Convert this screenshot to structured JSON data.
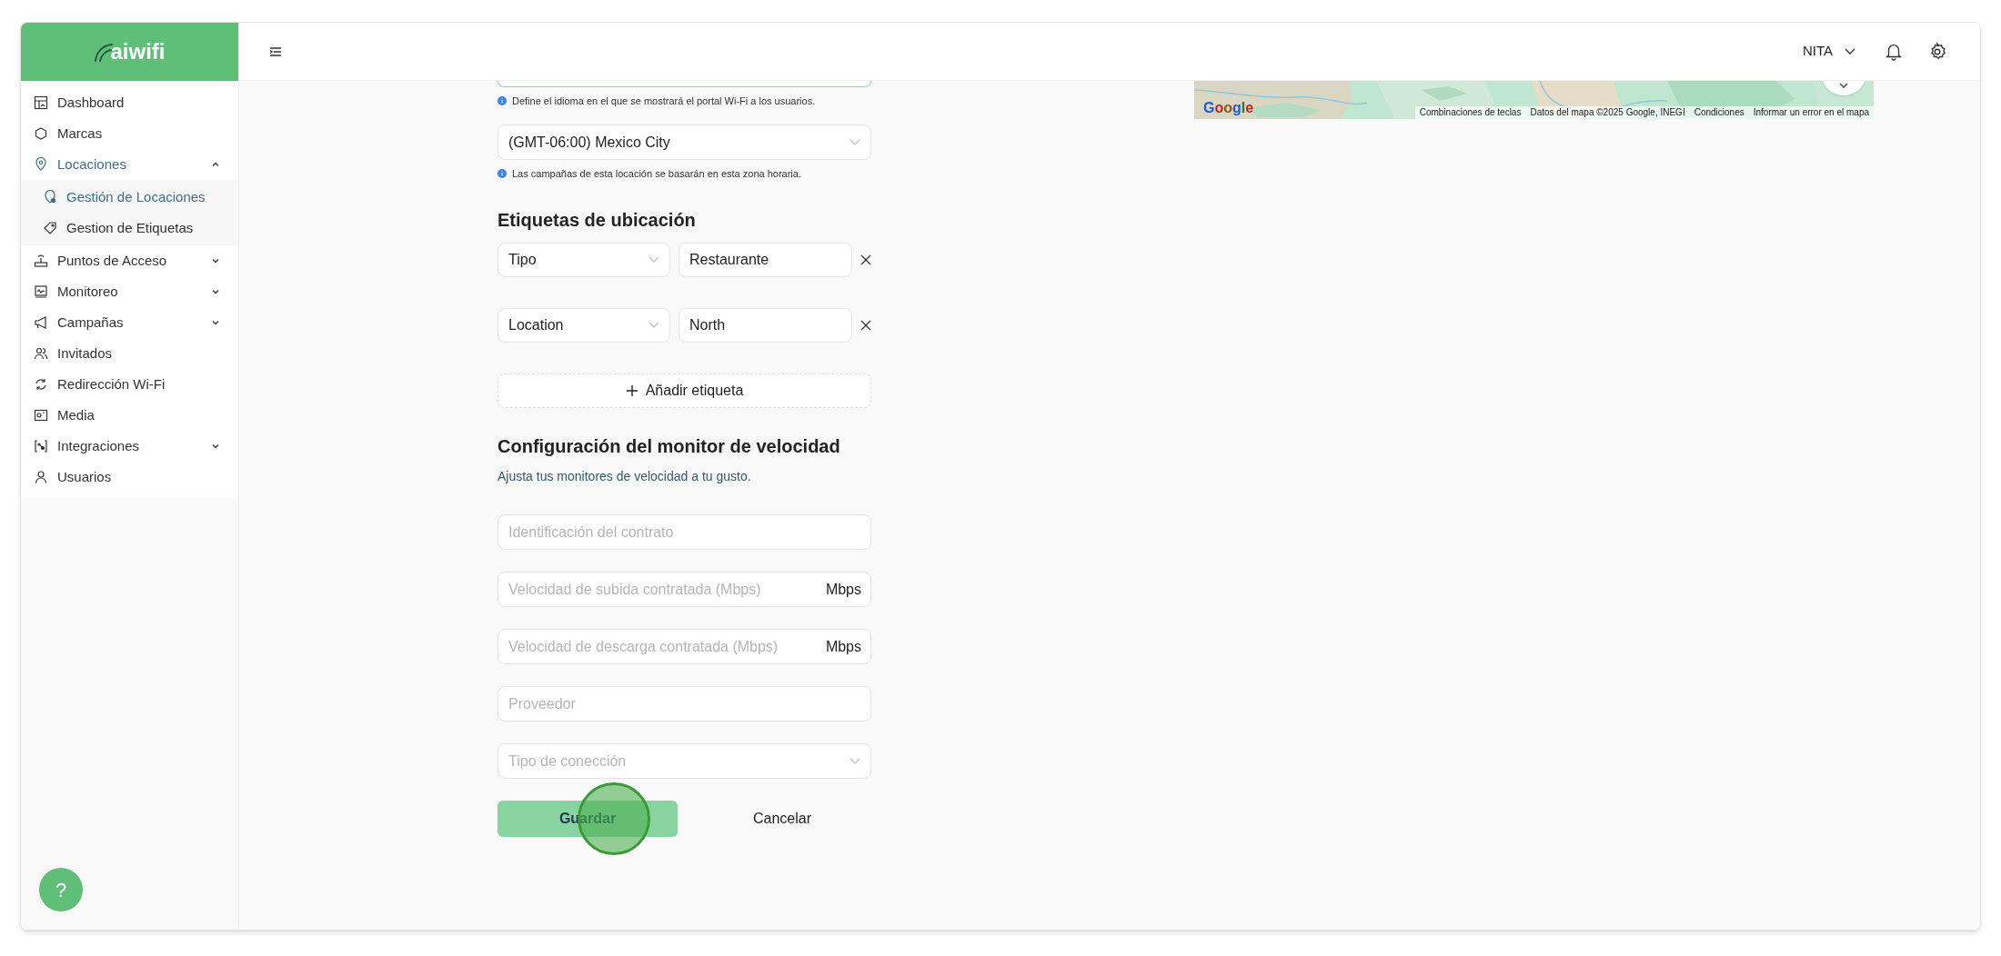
{
  "logo": {
    "text": "aiwifi"
  },
  "sidebar": {
    "items": [
      {
        "kind": "link",
        "label": "Dashboard",
        "selected": false
      },
      {
        "kind": "link",
        "label": "Marcas",
        "selected": false
      },
      {
        "kind": "group",
        "label": "Locaciones",
        "selected": true,
        "expanded": true,
        "children": [
          {
            "label": "Gestión de Locaciones",
            "selected": true
          },
          {
            "label": "Gestion de Etiquetas",
            "selected": false
          }
        ]
      },
      {
        "kind": "group",
        "label": "Puntos de Acceso",
        "selected": false,
        "expanded": false
      },
      {
        "kind": "group",
        "label": "Monitoreo",
        "selected": false,
        "expanded": false
      },
      {
        "kind": "group",
        "label": "Campañas",
        "selected": false,
        "expanded": false
      },
      {
        "kind": "link",
        "label": "Invitados",
        "selected": false
      },
      {
        "kind": "link",
        "label": "Redirección Wi-Fi",
        "selected": false
      },
      {
        "kind": "link",
        "label": "Media",
        "selected": false
      },
      {
        "kind": "group",
        "label": "Integraciones",
        "selected": false,
        "expanded": false
      },
      {
        "kind": "link",
        "label": "Usuarios",
        "selected": false
      }
    ]
  },
  "header": {
    "user": "NITA"
  },
  "map": {
    "kind": "picture",
    "logo": "Google",
    "attribution": [
      "Combinaciones de teclas",
      "Datos del mapa ©2025 Google, INEGI",
      "Condiciones",
      "Informar un error en el mapa"
    ]
  },
  "form": {
    "language_hint": "Define el idioma en el que se mostrará el portal Wi-Fi a los usuarios.",
    "timezone": {
      "value": "(GMT-06:00) Mexico City",
      "hint": "Las campañas de esta locación se basarán en esta zona horaria."
    },
    "tags_section": {
      "title": "Etiquetas de ubicación",
      "tags": [
        {
          "key": "Tipo",
          "value": "Restaurante"
        },
        {
          "key": "Location",
          "value": "North"
        }
      ],
      "add_label": "Añadir etiqueta"
    },
    "speed_section": {
      "title": "Configuración del monitor de velocidad",
      "subtitle": "Ajusta tus monitores de velocidad a tu gusto.",
      "fields": [
        {
          "kind": "text",
          "placeholder": "Identificación del contrato"
        },
        {
          "kind": "unit",
          "placeholder": "Velocidad de subida contratada (Mbps)",
          "unit": "Mbps"
        },
        {
          "kind": "unit",
          "placeholder": "Velocidad de descarga contratada (Mbps)",
          "unit": "Mbps"
        },
        {
          "kind": "text",
          "placeholder": "Proveedor"
        },
        {
          "kind": "select",
          "placeholder": "Tipo de conección"
        }
      ]
    },
    "buttons": {
      "save": "Guardar",
      "cancel": "Cancelar"
    }
  },
  "help": {
    "label": "?"
  }
}
